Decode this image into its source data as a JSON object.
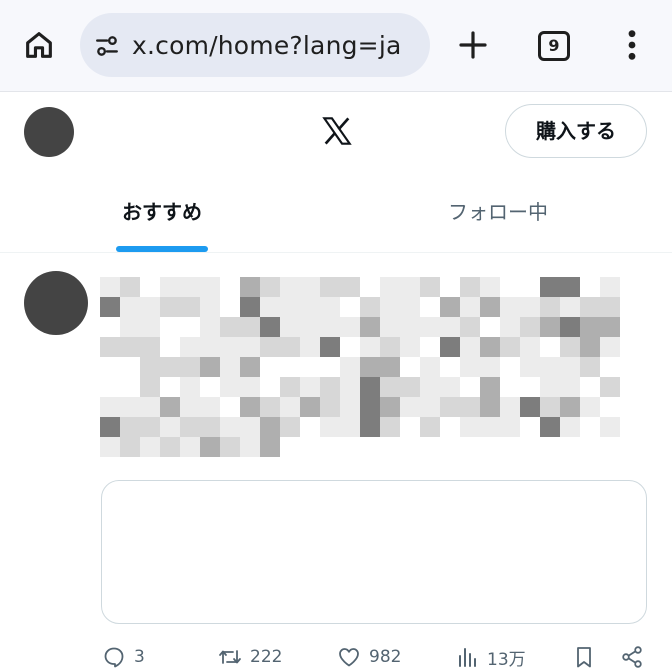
{
  "browser": {
    "url": "x.com/home?lang=ja",
    "tab_count": "9",
    "icons": [
      "home-icon",
      "tune-icon",
      "plus-icon",
      "more-vertical-icon"
    ]
  },
  "header": {
    "logo": "x-logo",
    "buy_label": "購入する"
  },
  "tabs": [
    {
      "label": "おすすめ",
      "active": true
    },
    {
      "label": "フォロー中",
      "active": false
    }
  ],
  "post": {
    "text_pixelated": true,
    "actions": {
      "replies": "3",
      "reposts": "222",
      "likes": "982",
      "views": "13万"
    }
  },
  "colors": {
    "accent": "#1d9bf0",
    "avatar": "#444444",
    "muted_text": "#536471"
  }
}
